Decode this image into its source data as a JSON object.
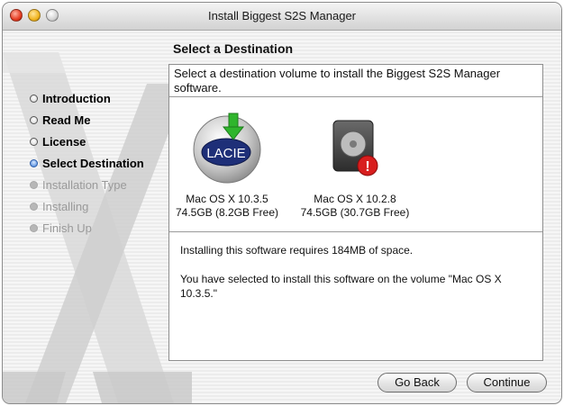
{
  "window": {
    "title": "Install Biggest S2S Manager"
  },
  "sidebar": {
    "steps": [
      {
        "label": "Introduction",
        "state": "done"
      },
      {
        "label": "Read Me",
        "state": "done"
      },
      {
        "label": "License",
        "state": "done"
      },
      {
        "label": "Select Destination",
        "state": "current"
      },
      {
        "label": "Installation Type",
        "state": "pending"
      },
      {
        "label": "Installing",
        "state": "pending"
      },
      {
        "label": "Finish Up",
        "state": "pending"
      }
    ]
  },
  "main": {
    "heading": "Select a Destination",
    "instruction": "Select a destination volume to install the Biggest S2S Manager software.",
    "volumes": [
      {
        "name": "Mac OS X 10.3.5",
        "space": "74.5GB (8.2GB Free)",
        "icon": "lacie-drive-icon",
        "logo_text": "LACIE",
        "selected": true
      },
      {
        "name": "Mac OS X 10.2.8",
        "space": "74.5GB (30.7GB Free)",
        "icon": "hard-drive-alert-icon",
        "alert": "!",
        "selected": false
      }
    ],
    "requirement": "Installing this software requires 184MB of space.",
    "selection_note": "You have selected to install this software on the volume \"Mac OS X 10.3.5.\""
  },
  "buttons": {
    "back": "Go Back",
    "continue": "Continue"
  },
  "colors": {
    "accent_blue": "#3b7bd8",
    "alert_red": "#d81e1e",
    "arrow_green": "#2fb52c"
  }
}
